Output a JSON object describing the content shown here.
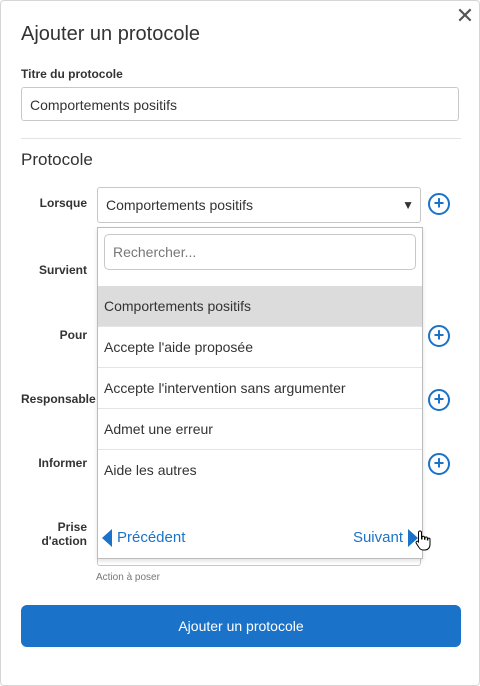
{
  "dialog": {
    "title": "Ajouter un protocole",
    "close_glyph": "✕"
  },
  "protocol_title": {
    "label": "Titre du protocole",
    "value": "Comportements positifs"
  },
  "section": {
    "title": "Protocole"
  },
  "rows": {
    "lorsque": "Lorsque",
    "survient": "Survient",
    "pour": "Pour",
    "responsable": "Responsable",
    "informer": "Informer",
    "prise_action": "Prise d'action"
  },
  "select": {
    "value": "Comportements positifs",
    "arrow": "▼"
  },
  "dropdown": {
    "search_placeholder": "Rechercher...",
    "options": [
      "Comportements positifs",
      "Accepte l'aide proposée",
      "Accepte l'intervention sans argumenter",
      "Admet une erreur",
      "Aide les autres"
    ],
    "hovered_index": 0,
    "prev_label": "Précédent",
    "next_label": "Suivant"
  },
  "helper_text": "Action à poser",
  "submit_label": "Ajouter un protocole",
  "colors": {
    "accent": "#1a73c8",
    "hover_row": "#dcdcdc",
    "border": "#c8c8c8"
  },
  "icons": {
    "add": "plus-circle-icon",
    "close": "close-icon",
    "cursor": "hand-pointer-icon"
  }
}
